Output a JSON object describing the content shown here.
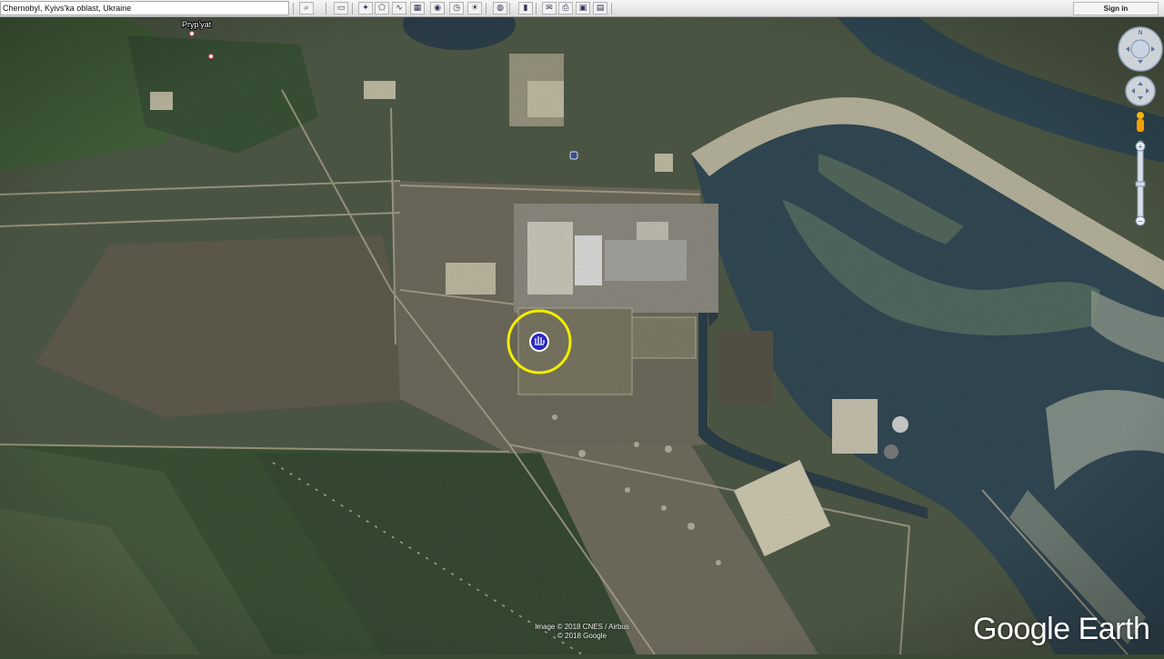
{
  "search": {
    "value": "Chernobyl, Kyivs'ka oblast, Ukraine"
  },
  "toolbar": {
    "buttons": [
      {
        "name": "search-icon",
        "glyph": "⌕"
      },
      {
        "name": "panel-toggle-icon",
        "glyph": "▭"
      },
      {
        "name": "placemark-icon",
        "glyph": "✦"
      },
      {
        "name": "polygon-icon",
        "glyph": "⬠"
      },
      {
        "name": "path-icon",
        "glyph": "∿"
      },
      {
        "name": "image-overlay-icon",
        "glyph": "▦"
      },
      {
        "name": "tour-icon",
        "glyph": "◉"
      },
      {
        "name": "historical-imagery-icon",
        "glyph": "◷"
      },
      {
        "name": "sunlight-icon",
        "glyph": "☀"
      },
      {
        "name": "planets-icon",
        "glyph": "◍"
      },
      {
        "name": "ruler-icon",
        "glyph": "▮"
      },
      {
        "name": "email-icon",
        "glyph": "✉"
      },
      {
        "name": "print-icon",
        "glyph": "⎙"
      },
      {
        "name": "save-image-icon",
        "glyph": "▣"
      },
      {
        "name": "maps-icon",
        "glyph": "▤"
      }
    ],
    "signin_label": "Sign in"
  },
  "map": {
    "labels": {
      "town": "Pryp'yat"
    },
    "colors": {
      "water": "#243c4e",
      "land": "#3a4a35",
      "sand": "#d8d2b8",
      "highlight": "#f2ee00",
      "cursor": "#2a2ac0"
    }
  },
  "attribution": {
    "line1": "Image © 2018 CNES / Airbus",
    "line2": "© 2018 Google"
  },
  "logo": "Google Earth"
}
